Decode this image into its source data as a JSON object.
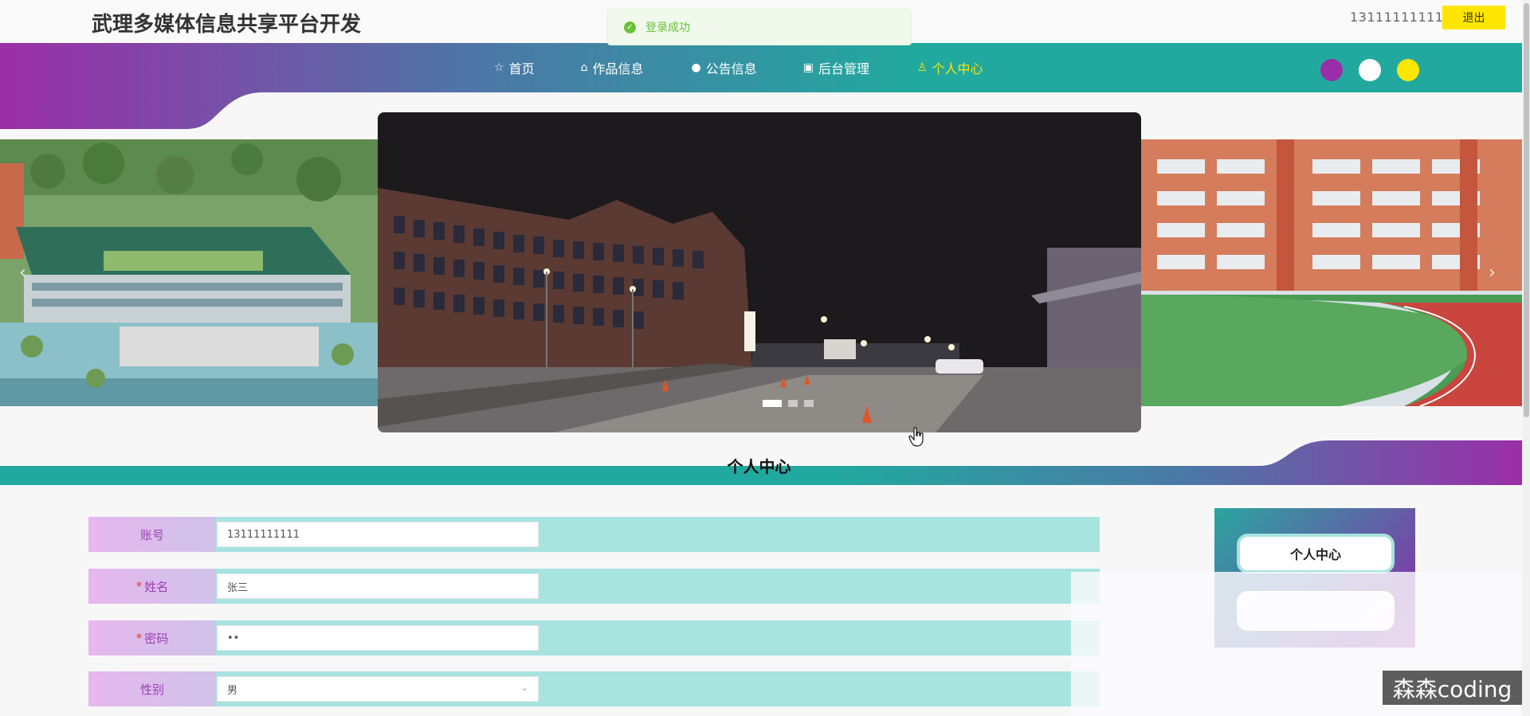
{
  "header": {
    "site_title": "武理多媒体信息共享平台开发",
    "user_account": "13111111111",
    "logout_label": "退出"
  },
  "toast": {
    "message": "登录成功",
    "type": "success"
  },
  "nav": {
    "items": [
      {
        "label": "首页",
        "icon": "star-icon"
      },
      {
        "label": "作品信息",
        "icon": "bag-icon"
      },
      {
        "label": "公告信息",
        "icon": "info-icon"
      },
      {
        "label": "后台管理",
        "icon": "briefcase-icon"
      },
      {
        "label": "个人中心",
        "icon": "user-icon",
        "active": true
      }
    ],
    "theme_colors": [
      "#9b2ea8",
      "#ffffff",
      "#ffe600"
    ]
  },
  "carousel": {
    "slides": [
      "campus-aerial",
      "campus-night",
      "school-track"
    ],
    "active_index": 0,
    "indicator_count": 3
  },
  "section": {
    "title": "个人中心"
  },
  "form": {
    "fields": [
      {
        "label": "账号",
        "required": false,
        "value": "13111111111",
        "type": "text"
      },
      {
        "label": "姓名",
        "required": true,
        "value": "张三",
        "type": "text"
      },
      {
        "label": "密码",
        "required": true,
        "value": "••",
        "type": "password"
      },
      {
        "label": "性别",
        "required": false,
        "value": "男",
        "type": "select"
      }
    ]
  },
  "side_panel": {
    "buttons": [
      {
        "label": "个人中心"
      }
    ]
  },
  "watermark": "森森coding",
  "colors": {
    "accent_teal": "#22a99f",
    "accent_purple": "#9b2ea8",
    "accent_yellow": "#ffe600",
    "form_row": "#a7e3df"
  }
}
